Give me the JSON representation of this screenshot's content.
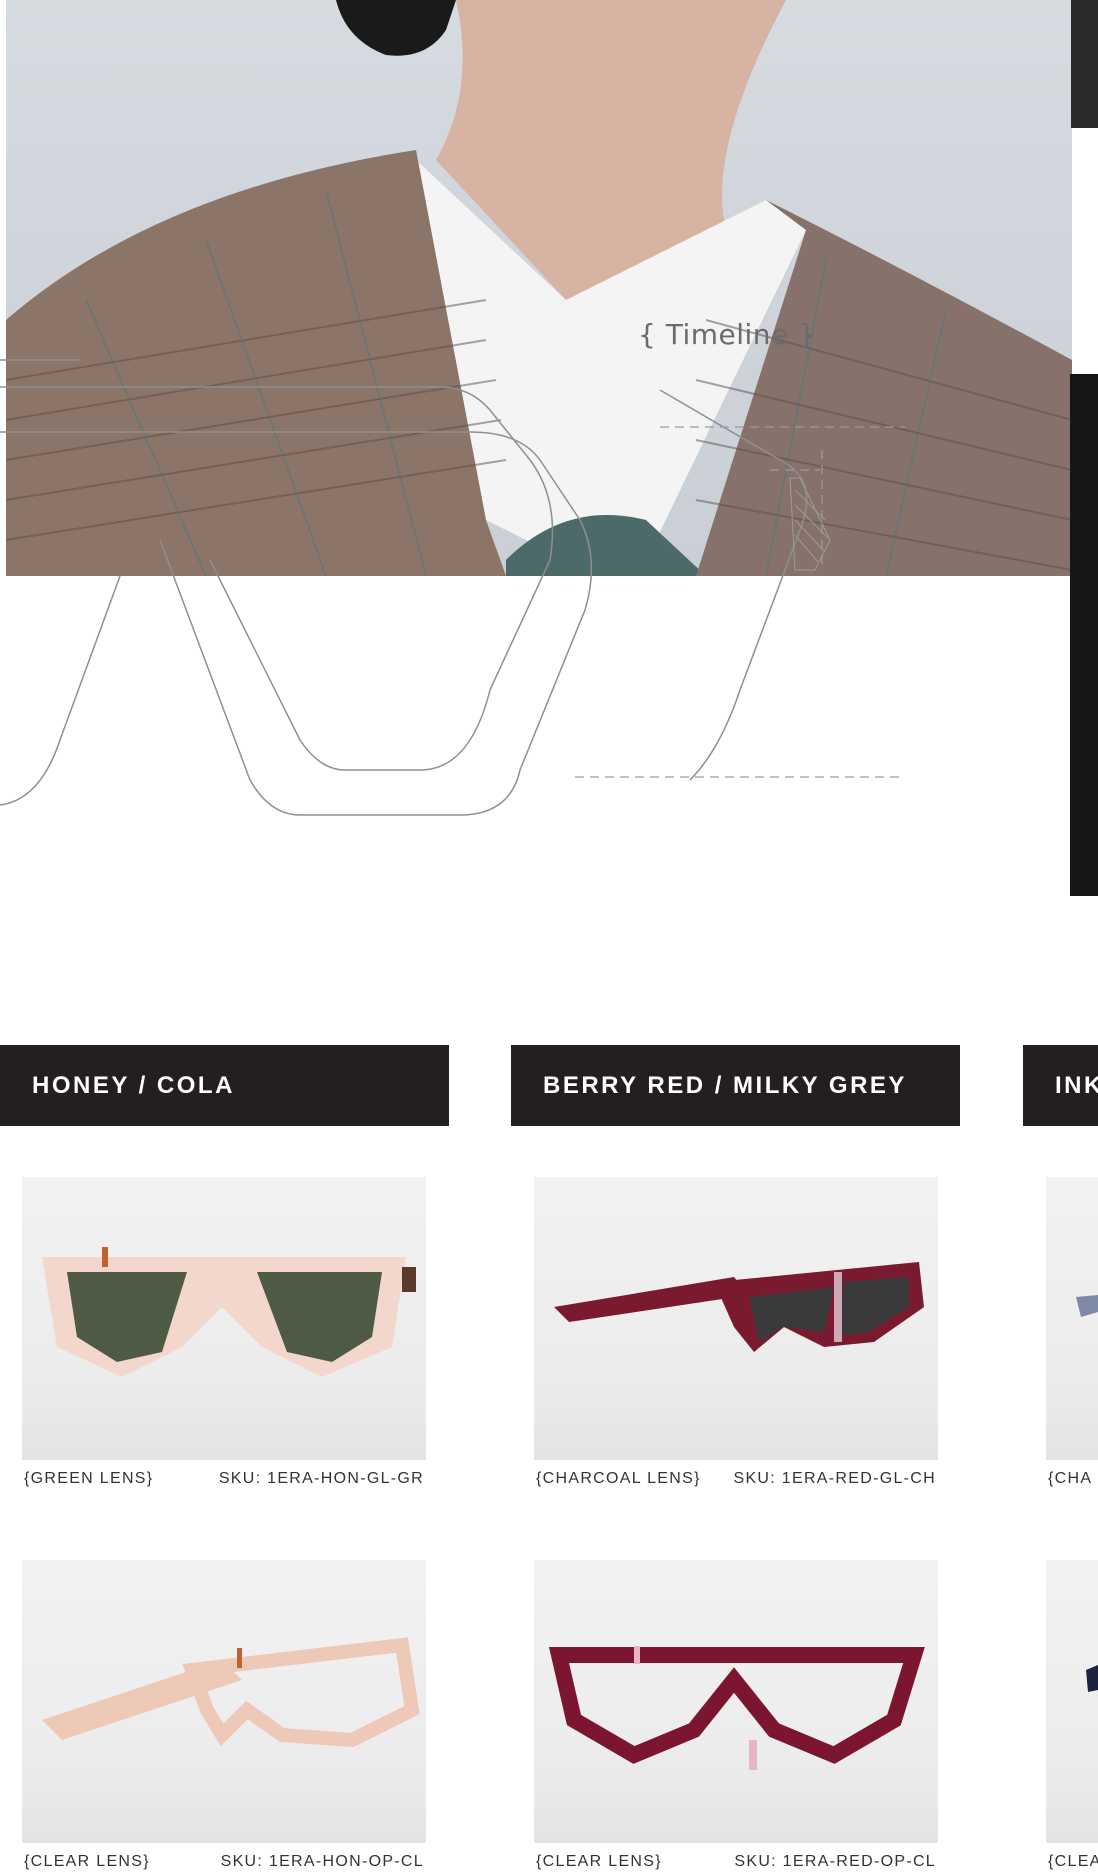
{
  "hero": {
    "timeline_label": "{ Timeline }"
  },
  "columns": [
    {
      "title": "HONEY / COLA",
      "items": [
        {
          "lens": "{GREEN LENS}",
          "sku": "SKU: 1ERA-HON-GL-GR",
          "frame_color": "#f3d6cc",
          "lens_color": "#4f5a45",
          "view": "front"
        },
        {
          "lens": "{CLEAR LENS}",
          "sku": "SKU: 1ERA-HON-OP-CL",
          "frame_color": "#efc9b8",
          "lens_color": "none",
          "view": "angle"
        }
      ]
    },
    {
      "title": "BERRY RED / MILKY GREY",
      "items": [
        {
          "lens": "{CHARCOAL LENS}",
          "sku": "SKU: 1ERA-RED-GL-CH",
          "frame_color": "#7a1a2e",
          "lens_color": "#3a3a3c",
          "view": "angle"
        },
        {
          "lens": "{CLEAR LENS}",
          "sku": "SKU: 1ERA-RED-OP-CL",
          "frame_color": "#7c1630",
          "lens_color": "none",
          "view": "front"
        }
      ]
    },
    {
      "title": "INK",
      "items": [
        {
          "lens": "{CHA",
          "sku": "",
          "frame_color": "#1d2340",
          "lens_color": "#3a3a3c",
          "view": "partial"
        },
        {
          "lens": "{CLEA",
          "sku": "",
          "frame_color": "#1d2340",
          "lens_color": "none",
          "view": "partial"
        }
      ]
    }
  ]
}
